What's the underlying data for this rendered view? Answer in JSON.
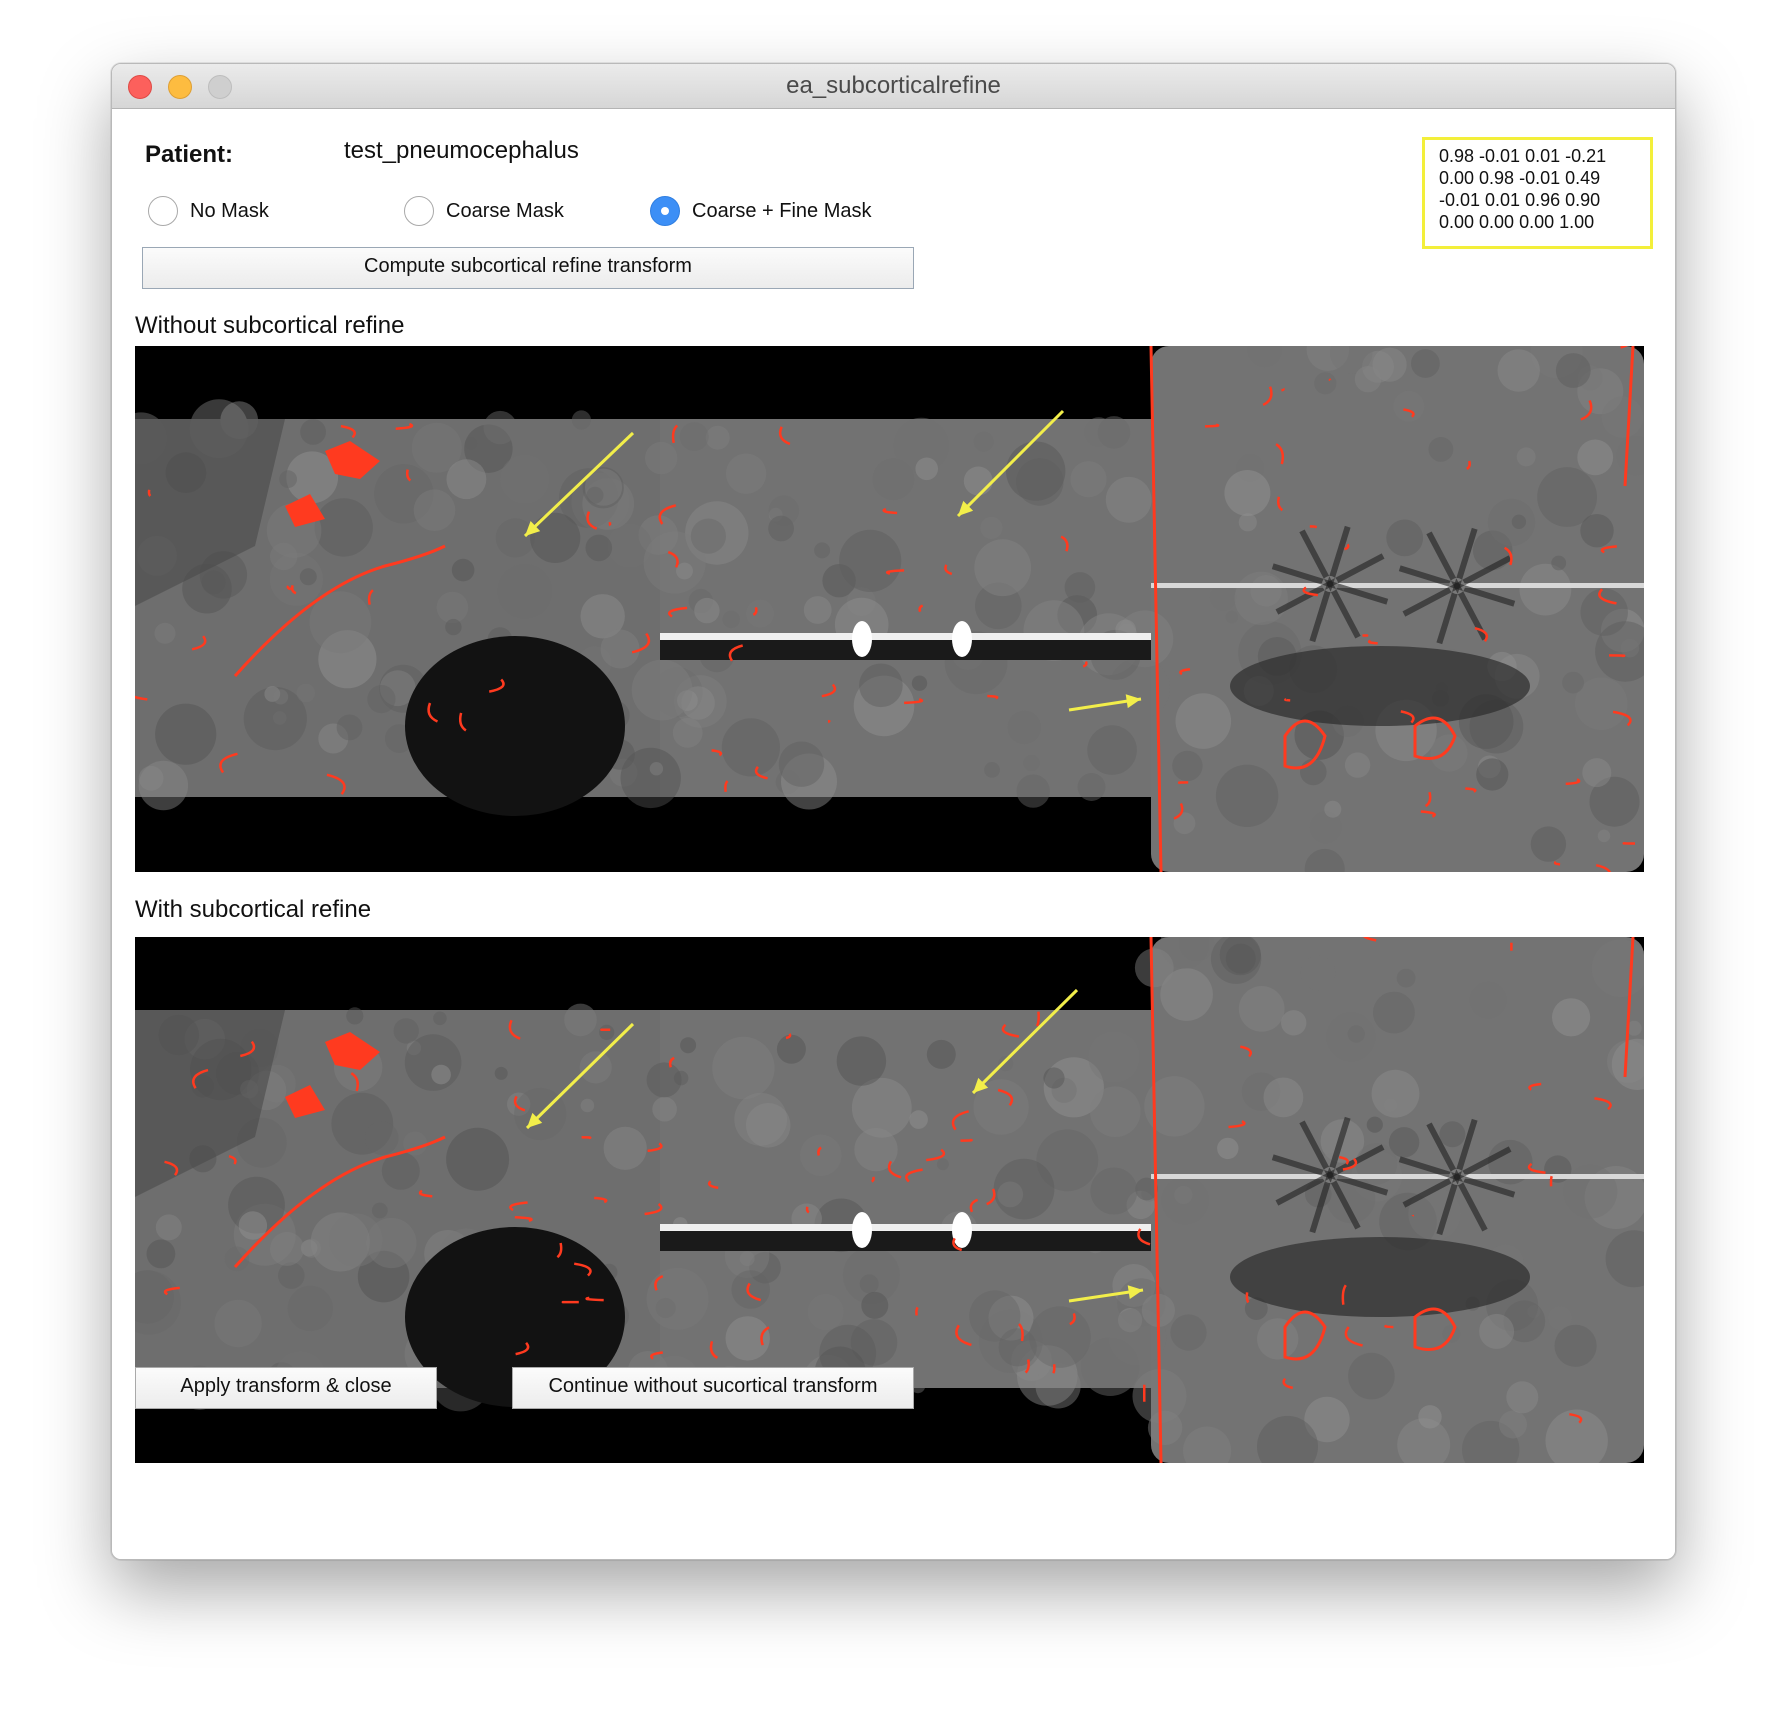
{
  "window": {
    "title": "ea_subcorticalrefine"
  },
  "patient": {
    "label": "Patient:",
    "name": "test_pneumocephalus"
  },
  "mask_options": [
    {
      "label": "No Mask",
      "selected": false
    },
    {
      "label": "Coarse Mask",
      "selected": false
    },
    {
      "label": "Coarse + Fine Mask",
      "selected": true
    }
  ],
  "compute_button": {
    "label": "Compute subcortical refine transform"
  },
  "transform_matrix": {
    "rows": [
      "0.98 -0.01 0.01 -0.21",
      "0.00 0.98 -0.01 0.49",
      "-0.01 0.01 0.96 0.90",
      "0.00 0.00 0.00 1.00"
    ]
  },
  "sections": {
    "without": {
      "label": "Without subcortical refine"
    },
    "with": {
      "label": "With subcortical refine"
    }
  },
  "footer": {
    "apply_label": "Apply transform & close",
    "continue_label": "Continue without sucortical transform"
  },
  "colors": {
    "overlay_outline": "#ff3a1f",
    "annotation_arrow": "#f2ee4a",
    "matrix_border": "#f3ef3a",
    "radio_selected": "#3c8ff6"
  }
}
